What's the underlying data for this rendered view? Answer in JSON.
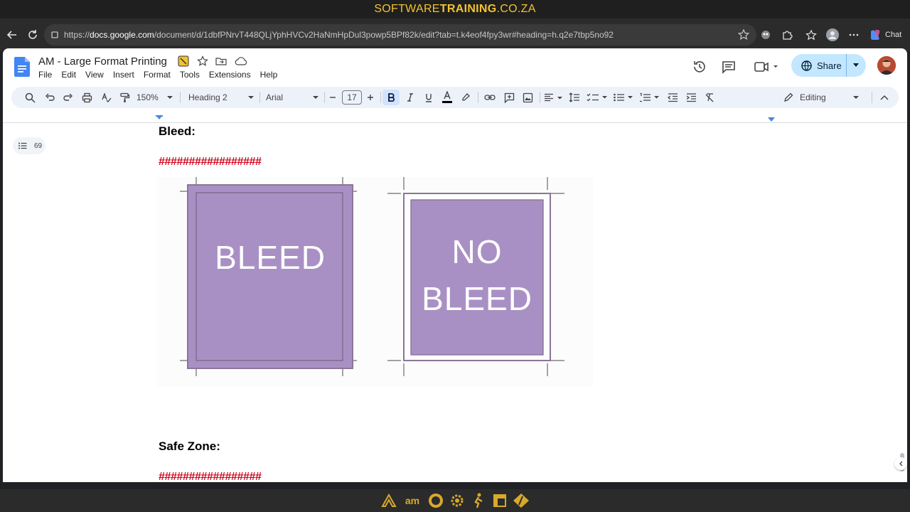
{
  "banner": {
    "text_a": "SOFTWARE",
    "text_b": "TRAINING",
    "text_c": ".CO.ZA"
  },
  "browser": {
    "url_prefix": "https://",
    "url_host": "docs.google.com",
    "url_path": "/document/d/1dbfPNrvT448QLjYphHVCv2HaNmHpDul3powp5BPf82k/edit?tab=t.k4eof4fpy3wr#heading=h.q2e7tbp5no92",
    "chat_label": "Chat"
  },
  "doc": {
    "title": "AM - Large Format Printing",
    "menu": [
      "File",
      "Edit",
      "View",
      "Insert",
      "Format",
      "Tools",
      "Extensions",
      "Help"
    ],
    "share_label": "Share",
    "brand_color": "#1a73e8"
  },
  "toolbar": {
    "zoom": "150%",
    "style": "Heading 2",
    "font": "Arial",
    "font_size": "17",
    "mode": "Editing"
  },
  "outline": {
    "count": "69"
  },
  "content": {
    "heading1": "Bleed:",
    "hashes1": "#################",
    "image_label_bleed": "BLEED",
    "image_label_nobleed_1": "NO",
    "image_label_nobleed_2": "BLEED",
    "heading2": "Safe Zone:",
    "hashes2": "#################",
    "swatch_color": "#a990c4"
  },
  "taskbar": {
    "am_label": "am"
  }
}
